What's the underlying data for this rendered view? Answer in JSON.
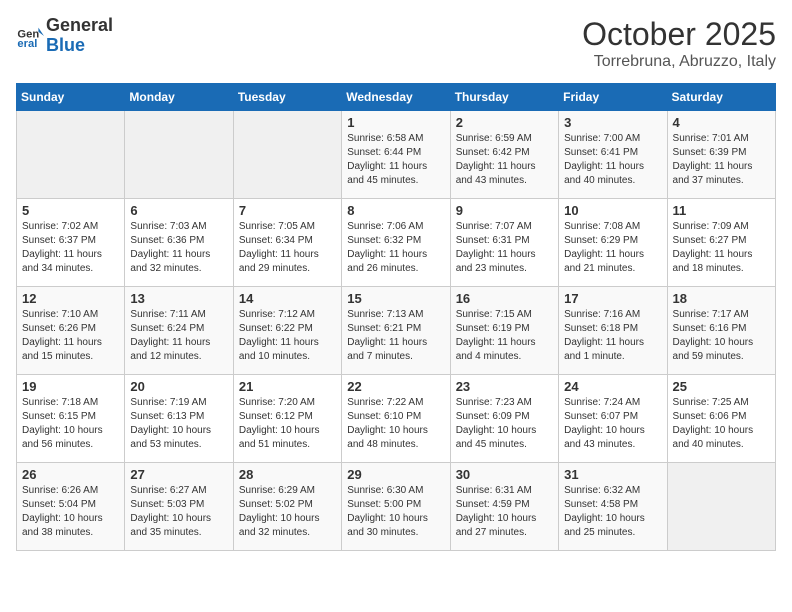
{
  "header": {
    "logo_line1": "General",
    "logo_line2": "Blue",
    "month": "October 2025",
    "location": "Torrebruna, Abruzzo, Italy"
  },
  "weekdays": [
    "Sunday",
    "Monday",
    "Tuesday",
    "Wednesday",
    "Thursday",
    "Friday",
    "Saturday"
  ],
  "weeks": [
    [
      {
        "day": "",
        "info": ""
      },
      {
        "day": "",
        "info": ""
      },
      {
        "day": "",
        "info": ""
      },
      {
        "day": "1",
        "info": "Sunrise: 6:58 AM\nSunset: 6:44 PM\nDaylight: 11 hours\nand 45 minutes."
      },
      {
        "day": "2",
        "info": "Sunrise: 6:59 AM\nSunset: 6:42 PM\nDaylight: 11 hours\nand 43 minutes."
      },
      {
        "day": "3",
        "info": "Sunrise: 7:00 AM\nSunset: 6:41 PM\nDaylight: 11 hours\nand 40 minutes."
      },
      {
        "day": "4",
        "info": "Sunrise: 7:01 AM\nSunset: 6:39 PM\nDaylight: 11 hours\nand 37 minutes."
      }
    ],
    [
      {
        "day": "5",
        "info": "Sunrise: 7:02 AM\nSunset: 6:37 PM\nDaylight: 11 hours\nand 34 minutes."
      },
      {
        "day": "6",
        "info": "Sunrise: 7:03 AM\nSunset: 6:36 PM\nDaylight: 11 hours\nand 32 minutes."
      },
      {
        "day": "7",
        "info": "Sunrise: 7:05 AM\nSunset: 6:34 PM\nDaylight: 11 hours\nand 29 minutes."
      },
      {
        "day": "8",
        "info": "Sunrise: 7:06 AM\nSunset: 6:32 PM\nDaylight: 11 hours\nand 26 minutes."
      },
      {
        "day": "9",
        "info": "Sunrise: 7:07 AM\nSunset: 6:31 PM\nDaylight: 11 hours\nand 23 minutes."
      },
      {
        "day": "10",
        "info": "Sunrise: 7:08 AM\nSunset: 6:29 PM\nDaylight: 11 hours\nand 21 minutes."
      },
      {
        "day": "11",
        "info": "Sunrise: 7:09 AM\nSunset: 6:27 PM\nDaylight: 11 hours\nand 18 minutes."
      }
    ],
    [
      {
        "day": "12",
        "info": "Sunrise: 7:10 AM\nSunset: 6:26 PM\nDaylight: 11 hours\nand 15 minutes."
      },
      {
        "day": "13",
        "info": "Sunrise: 7:11 AM\nSunset: 6:24 PM\nDaylight: 11 hours\nand 12 minutes."
      },
      {
        "day": "14",
        "info": "Sunrise: 7:12 AM\nSunset: 6:22 PM\nDaylight: 11 hours\nand 10 minutes."
      },
      {
        "day": "15",
        "info": "Sunrise: 7:13 AM\nSunset: 6:21 PM\nDaylight: 11 hours\nand 7 minutes."
      },
      {
        "day": "16",
        "info": "Sunrise: 7:15 AM\nSunset: 6:19 PM\nDaylight: 11 hours\nand 4 minutes."
      },
      {
        "day": "17",
        "info": "Sunrise: 7:16 AM\nSunset: 6:18 PM\nDaylight: 11 hours\nand 1 minute."
      },
      {
        "day": "18",
        "info": "Sunrise: 7:17 AM\nSunset: 6:16 PM\nDaylight: 10 hours\nand 59 minutes."
      }
    ],
    [
      {
        "day": "19",
        "info": "Sunrise: 7:18 AM\nSunset: 6:15 PM\nDaylight: 10 hours\nand 56 minutes."
      },
      {
        "day": "20",
        "info": "Sunrise: 7:19 AM\nSunset: 6:13 PM\nDaylight: 10 hours\nand 53 minutes."
      },
      {
        "day": "21",
        "info": "Sunrise: 7:20 AM\nSunset: 6:12 PM\nDaylight: 10 hours\nand 51 minutes."
      },
      {
        "day": "22",
        "info": "Sunrise: 7:22 AM\nSunset: 6:10 PM\nDaylight: 10 hours\nand 48 minutes."
      },
      {
        "day": "23",
        "info": "Sunrise: 7:23 AM\nSunset: 6:09 PM\nDaylight: 10 hours\nand 45 minutes."
      },
      {
        "day": "24",
        "info": "Sunrise: 7:24 AM\nSunset: 6:07 PM\nDaylight: 10 hours\nand 43 minutes."
      },
      {
        "day": "25",
        "info": "Sunrise: 7:25 AM\nSunset: 6:06 PM\nDaylight: 10 hours\nand 40 minutes."
      }
    ],
    [
      {
        "day": "26",
        "info": "Sunrise: 6:26 AM\nSunset: 5:04 PM\nDaylight: 10 hours\nand 38 minutes."
      },
      {
        "day": "27",
        "info": "Sunrise: 6:27 AM\nSunset: 5:03 PM\nDaylight: 10 hours\nand 35 minutes."
      },
      {
        "day": "28",
        "info": "Sunrise: 6:29 AM\nSunset: 5:02 PM\nDaylight: 10 hours\nand 32 minutes."
      },
      {
        "day": "29",
        "info": "Sunrise: 6:30 AM\nSunset: 5:00 PM\nDaylight: 10 hours\nand 30 minutes."
      },
      {
        "day": "30",
        "info": "Sunrise: 6:31 AM\nSunset: 4:59 PM\nDaylight: 10 hours\nand 27 minutes."
      },
      {
        "day": "31",
        "info": "Sunrise: 6:32 AM\nSunset: 4:58 PM\nDaylight: 10 hours\nand 25 minutes."
      },
      {
        "day": "",
        "info": ""
      }
    ]
  ]
}
